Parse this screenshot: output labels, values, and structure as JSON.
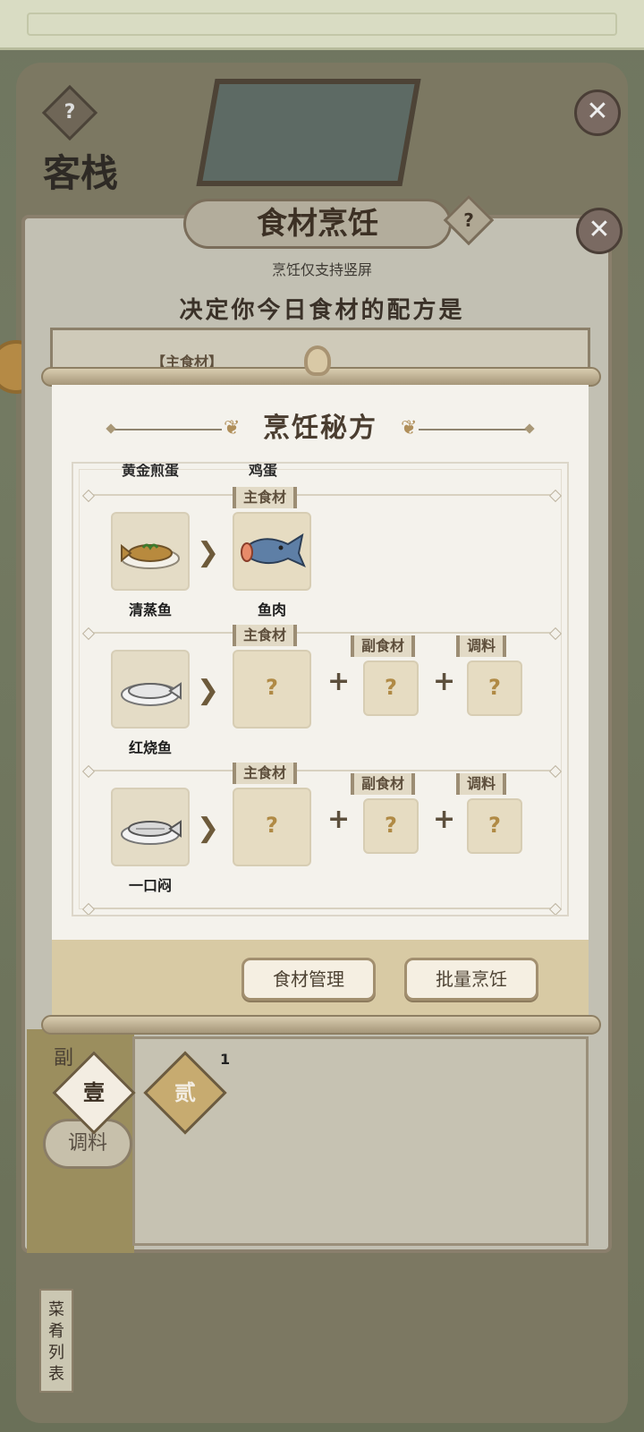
{
  "background": {
    "room_sign": "客栈",
    "help_icon": "?",
    "close_icon": "✕"
  },
  "cooking_panel": {
    "title": "食材烹饪",
    "help_icon": "?",
    "subtitle": "烹饪仅支持竖屏",
    "prompt": "决定你今日食材的配方是",
    "box_label": "【主食材】",
    "tabs": [
      {
        "label": "壹",
        "selected": true
      },
      {
        "label": "贰",
        "selected": false
      }
    ],
    "side_tab_top": "副",
    "side_tab_bottom": "调料",
    "count_badge": "1",
    "dish_list_label": "菜肴列表"
  },
  "recipe_modal": {
    "title": "烹饪秘方",
    "clipped_row": {
      "dish": "黄金煎蛋",
      "ingredient": "鸡蛋"
    },
    "labels": {
      "main": "主食材",
      "side": "副食材",
      "seasoning": "调料"
    },
    "recipes": [
      {
        "dish": "清蒸鱼",
        "main": "鱼肉",
        "side": null,
        "seasoning": null
      },
      {
        "dish": "红烧鱼",
        "main": "?",
        "side": "?",
        "seasoning": "?"
      },
      {
        "dish": "一口闷",
        "main": "?",
        "side": "?",
        "seasoning": "?"
      }
    ],
    "buttons": {
      "manage": "食材管理",
      "batch": "批量烹饪"
    }
  },
  "colors": {
    "accent": "#b08a45",
    "panel": "#f4f2ec",
    "footer": "#d8caa4"
  }
}
